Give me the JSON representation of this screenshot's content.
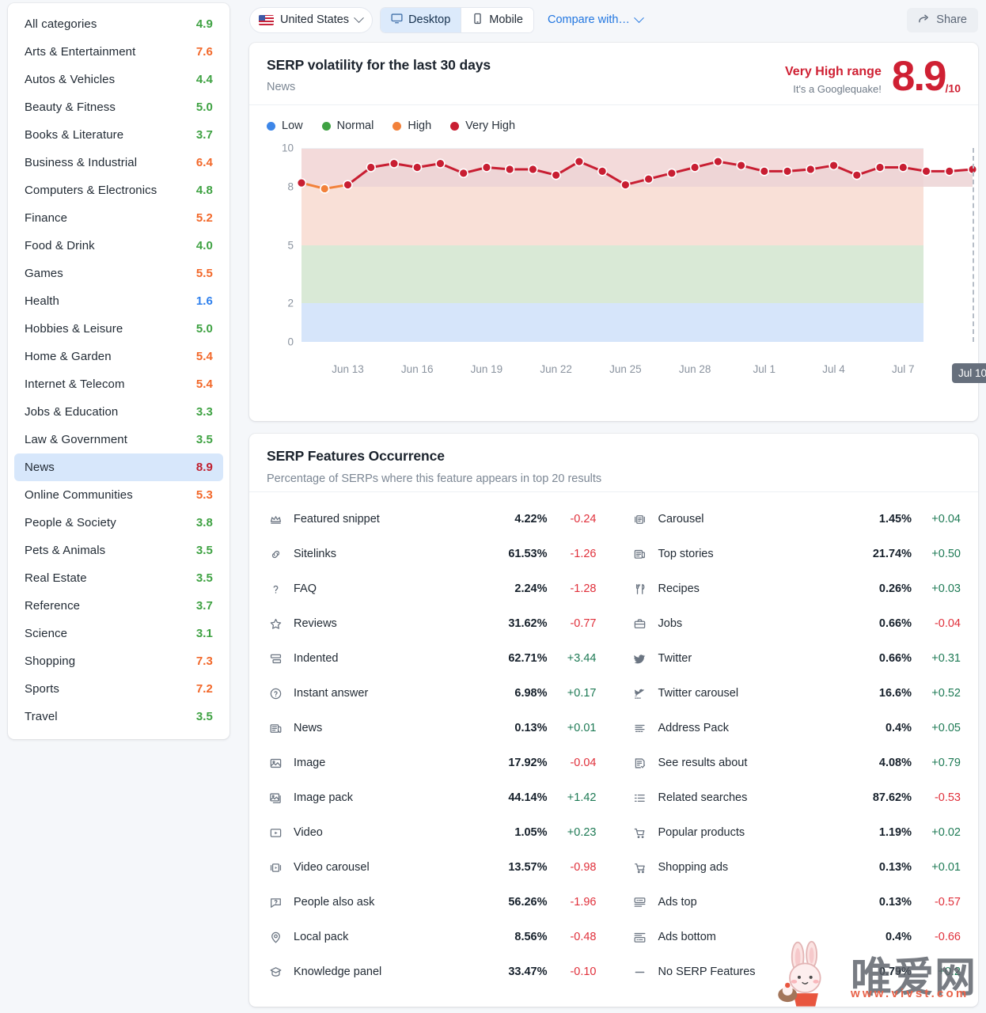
{
  "toolbar": {
    "country": "United States",
    "desktop": "Desktop",
    "mobile": "Mobile",
    "compare": "Compare with…",
    "share": "Share"
  },
  "sidebar": {
    "items": [
      {
        "label": "All categories",
        "value": "4.9",
        "level": "normal",
        "selected": false
      },
      {
        "label": "Arts & Entertainment",
        "value": "7.6",
        "level": "high",
        "selected": false
      },
      {
        "label": "Autos & Vehicles",
        "value": "4.4",
        "level": "normal",
        "selected": false
      },
      {
        "label": "Beauty & Fitness",
        "value": "5.0",
        "level": "normal",
        "selected": false
      },
      {
        "label": "Books & Literature",
        "value": "3.7",
        "level": "normal",
        "selected": false
      },
      {
        "label": "Business & Industrial",
        "value": "6.4",
        "level": "high",
        "selected": false
      },
      {
        "label": "Computers & Electronics",
        "value": "4.8",
        "level": "normal",
        "selected": false
      },
      {
        "label": "Finance",
        "value": "5.2",
        "level": "high",
        "selected": false
      },
      {
        "label": "Food & Drink",
        "value": "4.0",
        "level": "normal",
        "selected": false
      },
      {
        "label": "Games",
        "value": "5.5",
        "level": "high",
        "selected": false
      },
      {
        "label": "Health",
        "value": "1.6",
        "level": "low",
        "selected": false
      },
      {
        "label": "Hobbies & Leisure",
        "value": "5.0",
        "level": "normal",
        "selected": false
      },
      {
        "label": "Home & Garden",
        "value": "5.4",
        "level": "high",
        "selected": false
      },
      {
        "label": "Internet & Telecom",
        "value": "5.4",
        "level": "high",
        "selected": false
      },
      {
        "label": "Jobs & Education",
        "value": "3.3",
        "level": "normal",
        "selected": false
      },
      {
        "label": "Law & Government",
        "value": "3.5",
        "level": "normal",
        "selected": false
      },
      {
        "label": "News",
        "value": "8.9",
        "level": "vhigh",
        "selected": true
      },
      {
        "label": "Online Communities",
        "value": "5.3",
        "level": "high",
        "selected": false
      },
      {
        "label": "People & Society",
        "value": "3.8",
        "level": "normal",
        "selected": false
      },
      {
        "label": "Pets & Animals",
        "value": "3.5",
        "level": "normal",
        "selected": false
      },
      {
        "label": "Real Estate",
        "value": "3.5",
        "level": "normal",
        "selected": false
      },
      {
        "label": "Reference",
        "value": "3.7",
        "level": "normal",
        "selected": false
      },
      {
        "label": "Science",
        "value": "3.1",
        "level": "normal",
        "selected": false
      },
      {
        "label": "Shopping",
        "value": "7.3",
        "level": "high",
        "selected": false
      },
      {
        "label": "Sports",
        "value": "7.2",
        "level": "high",
        "selected": false
      },
      {
        "label": "Travel",
        "value": "3.5",
        "level": "normal",
        "selected": false
      }
    ]
  },
  "volatility": {
    "title": "SERP volatility for the last 30 days",
    "subtitle": "News",
    "range_label": "Very High range",
    "range_note": "It's a Googlequake!",
    "score": "8.9",
    "score_denominator": "/10"
  },
  "chart_data": {
    "type": "line",
    "title": "SERP volatility for the last 30 days",
    "xlabel": "",
    "ylabel": "",
    "ylim": [
      0,
      10
    ],
    "yticks": [
      0,
      2,
      5,
      8,
      10
    ],
    "grid": false,
    "legend_position": "top-left",
    "legend": [
      {
        "name": "Low",
        "color": "#3d86e8",
        "range": [
          0,
          2
        ]
      },
      {
        "name": "Normal",
        "color": "#3fa243",
        "range": [
          2,
          5
        ]
      },
      {
        "name": "High",
        "color": "#f2813a",
        "range": [
          5,
          8
        ]
      },
      {
        "name": "Very High",
        "color": "#c81e32",
        "range": [
          8,
          10
        ]
      }
    ],
    "bands": [
      {
        "name": "Low",
        "from": 0,
        "to": 2,
        "fill": "#d6e5fa"
      },
      {
        "name": "Normal",
        "from": 2,
        "to": 5,
        "fill": "#d9e9d6"
      },
      {
        "name": "High",
        "from": 5,
        "to": 8,
        "fill": "#f9e0d7"
      },
      {
        "name": "Very High",
        "from": 8,
        "to": 10,
        "fill": "#f3dada"
      }
    ],
    "xtick_labels": [
      "Jun 13",
      "Jun 16",
      "Jun 19",
      "Jun 22",
      "Jun 25",
      "Jun 28",
      "Jul 1",
      "Jul 4",
      "Jul 7",
      "Jul 10"
    ],
    "x": [
      "Jun 11",
      "Jun 12",
      "Jun 13",
      "Jun 14",
      "Jun 15",
      "Jun 16",
      "Jun 17",
      "Jun 18",
      "Jun 19",
      "Jun 20",
      "Jun 21",
      "Jun 22",
      "Jun 23",
      "Jun 24",
      "Jun 25",
      "Jun 26",
      "Jun 27",
      "Jun 28",
      "Jun 29",
      "Jun 30",
      "Jul 1",
      "Jul 2",
      "Jul 3",
      "Jul 4",
      "Jul 5",
      "Jul 6",
      "Jul 7",
      "Jul 8",
      "Jul 9",
      "Jul 10"
    ],
    "values": [
      8.2,
      7.9,
      8.1,
      9.0,
      9.2,
      9.0,
      9.2,
      8.7,
      9.0,
      8.9,
      8.9,
      8.6,
      9.3,
      8.8,
      8.1,
      8.4,
      8.7,
      9.0,
      9.3,
      9.1,
      8.8,
      8.8,
      8.9,
      9.1,
      8.6,
      9.0,
      9.0,
      8.8,
      8.8,
      8.9
    ],
    "point_colors": [
      "vhigh",
      "high",
      "vhigh",
      "vhigh",
      "vhigh",
      "vhigh",
      "vhigh",
      "vhigh",
      "vhigh",
      "vhigh",
      "vhigh",
      "vhigh",
      "vhigh",
      "vhigh",
      "vhigh",
      "vhigh",
      "vhigh",
      "vhigh",
      "vhigh",
      "vhigh",
      "vhigh",
      "vhigh",
      "vhigh",
      "vhigh",
      "vhigh",
      "vhigh",
      "vhigh",
      "vhigh",
      "vhigh",
      "vhigh"
    ],
    "selected_x": "Jul 10"
  },
  "features": {
    "title": "SERP Features Occurrence",
    "subtitle": "Percentage of SERPs where this feature appears in top 20 results",
    "left": [
      {
        "icon": "featured-snippet-icon",
        "name": "Featured snippet",
        "pct": "4.22%",
        "chg": "-0.24",
        "dir": "neg"
      },
      {
        "icon": "sitelinks-icon",
        "name": "Sitelinks",
        "pct": "61.53%",
        "chg": "-1.26",
        "dir": "neg"
      },
      {
        "icon": "faq-icon",
        "name": "FAQ",
        "pct": "2.24%",
        "chg": "-1.28",
        "dir": "neg"
      },
      {
        "icon": "reviews-star-icon",
        "name": "Reviews",
        "pct": "31.62%",
        "chg": "-0.77",
        "dir": "neg"
      },
      {
        "icon": "indented-icon",
        "name": "Indented",
        "pct": "62.71%",
        "chg": "+3.44",
        "dir": "pos"
      },
      {
        "icon": "instant-answer-icon",
        "name": "Instant answer",
        "pct": "6.98%",
        "chg": "+0.17",
        "dir": "pos"
      },
      {
        "icon": "news-icon",
        "name": "News",
        "pct": "0.13%",
        "chg": "+0.01",
        "dir": "pos"
      },
      {
        "icon": "image-icon",
        "name": "Image",
        "pct": "17.92%",
        "chg": "-0.04",
        "dir": "neg"
      },
      {
        "icon": "image-pack-icon",
        "name": "Image pack",
        "pct": "44.14%",
        "chg": "+1.42",
        "dir": "pos"
      },
      {
        "icon": "video-icon",
        "name": "Video",
        "pct": "1.05%",
        "chg": "+0.23",
        "dir": "pos"
      },
      {
        "icon": "video-carousel-icon",
        "name": "Video carousel",
        "pct": "13.57%",
        "chg": "-0.98",
        "dir": "neg"
      },
      {
        "icon": "people-also-ask-icon",
        "name": "People also ask",
        "pct": "56.26%",
        "chg": "-1.96",
        "dir": "neg"
      },
      {
        "icon": "local-pack-pin-icon",
        "name": "Local pack",
        "pct": "8.56%",
        "chg": "-0.48",
        "dir": "neg"
      },
      {
        "icon": "knowledge-panel-icon",
        "name": "Knowledge panel",
        "pct": "33.47%",
        "chg": "-0.10",
        "dir": "neg"
      }
    ],
    "right": [
      {
        "icon": "carousel-icon",
        "name": "Carousel",
        "pct": "1.45%",
        "chg": "+0.04",
        "dir": "pos"
      },
      {
        "icon": "top-stories-icon",
        "name": "Top stories",
        "pct": "21.74%",
        "chg": "+0.50",
        "dir": "pos"
      },
      {
        "icon": "recipes-icon",
        "name": "Recipes",
        "pct": "0.26%",
        "chg": "+0.03",
        "dir": "pos"
      },
      {
        "icon": "jobs-icon",
        "name": "Jobs",
        "pct": "0.66%",
        "chg": "-0.04",
        "dir": "neg"
      },
      {
        "icon": "twitter-icon",
        "name": "Twitter",
        "pct": "0.66%",
        "chg": "+0.31",
        "dir": "pos"
      },
      {
        "icon": "twitter-carousel-icon",
        "name": "Twitter carousel",
        "pct": "16.6%",
        "chg": "+0.52",
        "dir": "pos"
      },
      {
        "icon": "address-pack-icon",
        "name": "Address Pack",
        "pct": "0.4%",
        "chg": "+0.05",
        "dir": "pos"
      },
      {
        "icon": "see-results-about-icon",
        "name": "See results about",
        "pct": "4.08%",
        "chg": "+0.79",
        "dir": "pos"
      },
      {
        "icon": "related-searches-icon",
        "name": "Related searches",
        "pct": "87.62%",
        "chg": "-0.53",
        "dir": "neg"
      },
      {
        "icon": "popular-products-icon",
        "name": "Popular products",
        "pct": "1.19%",
        "chg": "+0.02",
        "dir": "pos"
      },
      {
        "icon": "shopping-ads-icon",
        "name": "Shopping ads",
        "pct": "0.13%",
        "chg": "+0.01",
        "dir": "pos"
      },
      {
        "icon": "ads-top-icon",
        "name": "Ads top",
        "pct": "0.13%",
        "chg": "-0.57",
        "dir": "neg"
      },
      {
        "icon": "ads-bottom-icon",
        "name": "Ads bottom",
        "pct": "0.4%",
        "chg": "-0.66",
        "dir": "neg"
      },
      {
        "icon": "no-features-dash-icon",
        "name": "No SERP Features",
        "pct": "0.79%",
        "chg": "+0.2",
        "dir": "pos"
      }
    ]
  },
  "watermark": {
    "text_cn": "唯爱网",
    "url": "www.vivst.com"
  }
}
